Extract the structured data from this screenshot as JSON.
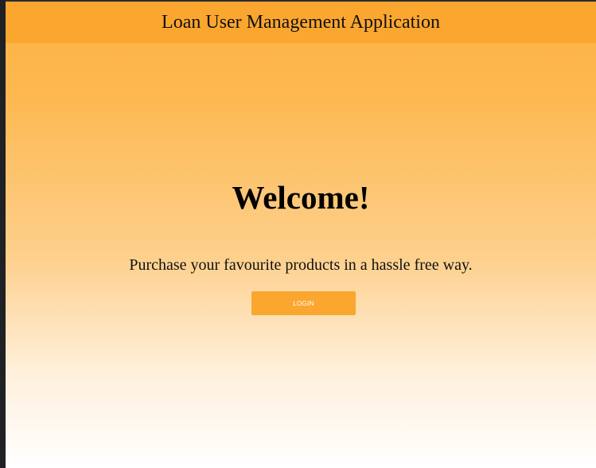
{
  "header": {
    "title": "Loan User Management Application"
  },
  "main": {
    "heading": "Welcome!",
    "tagline": "Purchase your favourite products in a hassle free way.",
    "login_label": "LOGIN"
  },
  "colors": {
    "header_bg": "#fba62f",
    "button_bg": "#fba62f",
    "gradient_top": "#fdb243",
    "gradient_bottom": "#ffffff",
    "window_bg": "#202124"
  }
}
